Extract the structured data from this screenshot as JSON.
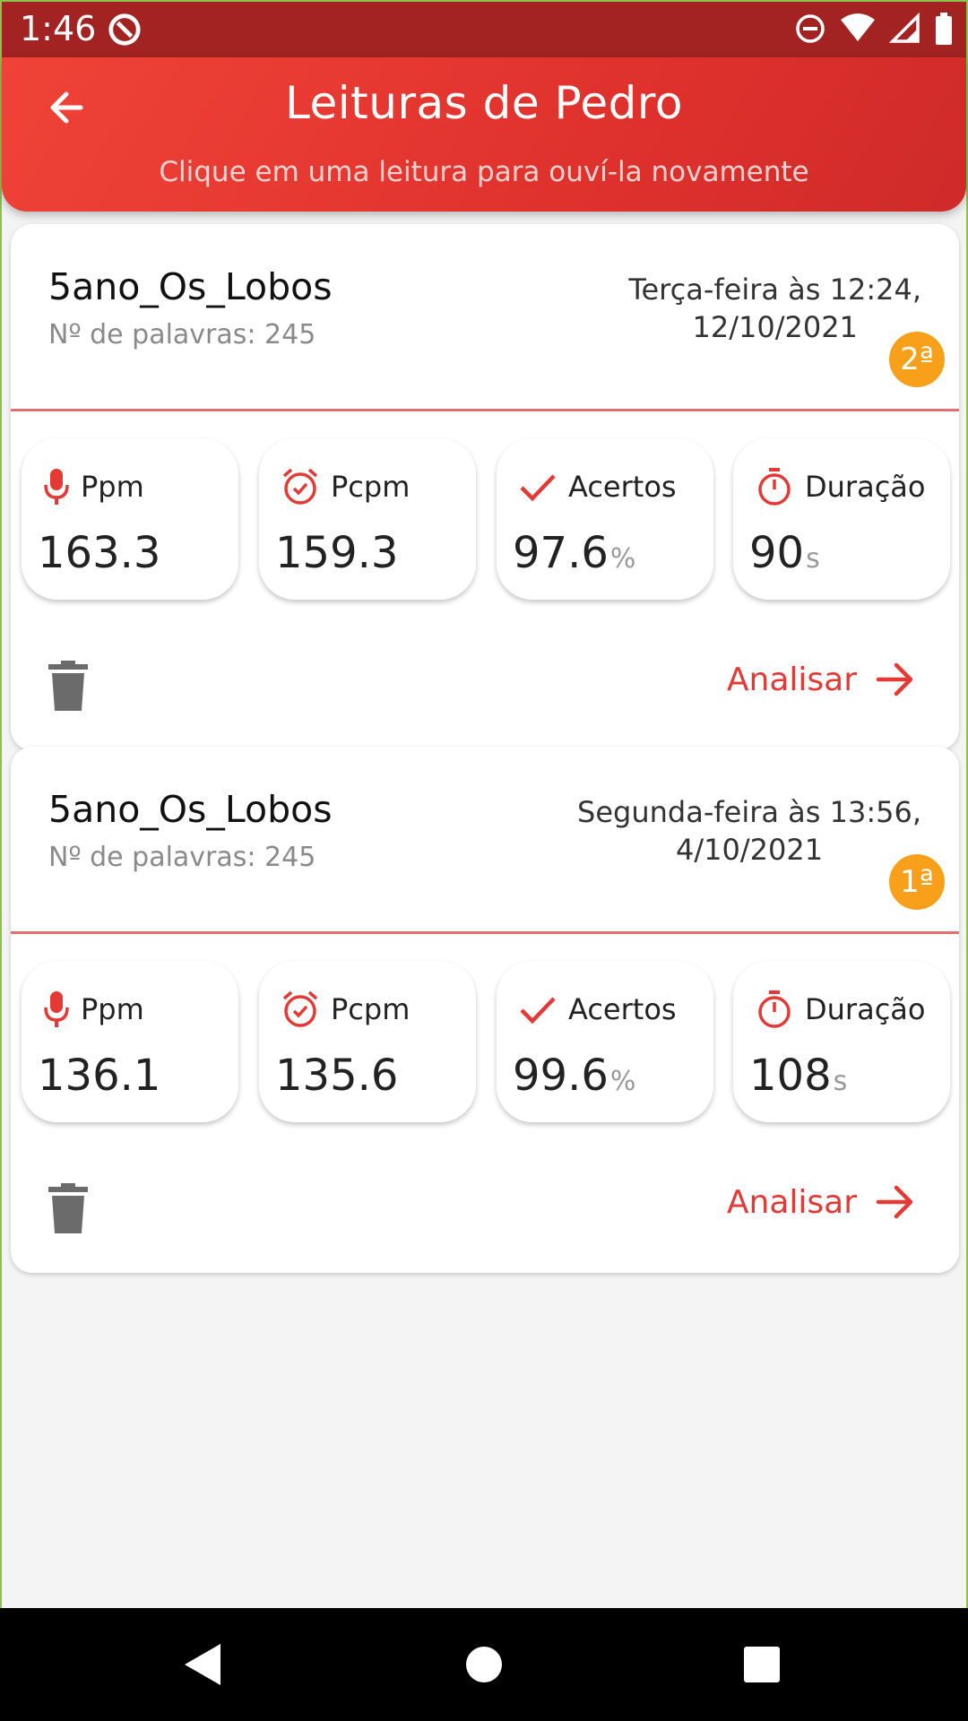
{
  "status_bar": {
    "time": "1:46",
    "icons": [
      "app-notification-icon",
      "do-not-disturb-icon",
      "wifi-icon",
      "signal-icon",
      "battery-icon"
    ]
  },
  "header": {
    "title": "Leituras de Pedro",
    "subtitle": "Clique em uma leitura para ouví-la novamente",
    "back_icon": "arrow-left-icon"
  },
  "colors": {
    "header_red": "#e5392f",
    "accent_red": "#e53935",
    "badge_orange": "#f9a01b",
    "divider": "#e46f6f"
  },
  "readings": [
    {
      "title": "5ano_Os_Lobos",
      "words": "Nº de palavras: 245",
      "date_line1": "Terça-feira às 12:24,",
      "date_line2": "12/10/2021",
      "badge": "2ª",
      "metrics": [
        {
          "icon": "microphone-icon",
          "label": "Ppm",
          "value": "163.3",
          "unit": ""
        },
        {
          "icon": "alarm-clock-icon",
          "label": "Pcpm",
          "value": "159.3",
          "unit": ""
        },
        {
          "icon": "check-icon",
          "label": "Acertos",
          "value": "97.6",
          "unit": "%"
        },
        {
          "icon": "timer-icon",
          "label": "Duração",
          "value": "90",
          "unit": "s"
        }
      ],
      "delete_icon": "trash-icon",
      "action_label": "Analisar"
    },
    {
      "title": "5ano_Os_Lobos",
      "words": "Nº de palavras: 245",
      "date_line1": "Segunda-feira às 13:56,",
      "date_line2": "4/10/2021",
      "badge": "1ª",
      "metrics": [
        {
          "icon": "microphone-icon",
          "label": "Ppm",
          "value": "136.1",
          "unit": ""
        },
        {
          "icon": "alarm-clock-icon",
          "label": "Pcpm",
          "value": "135.6",
          "unit": ""
        },
        {
          "icon": "check-icon",
          "label": "Acertos",
          "value": "99.6",
          "unit": "%"
        },
        {
          "icon": "timer-icon",
          "label": "Duração",
          "value": "108",
          "unit": "s"
        }
      ],
      "delete_icon": "trash-icon",
      "action_label": "Analisar"
    }
  ],
  "nav_bar": {
    "icons": [
      "back-triangle-icon",
      "home-circle-icon",
      "recents-square-icon"
    ]
  }
}
